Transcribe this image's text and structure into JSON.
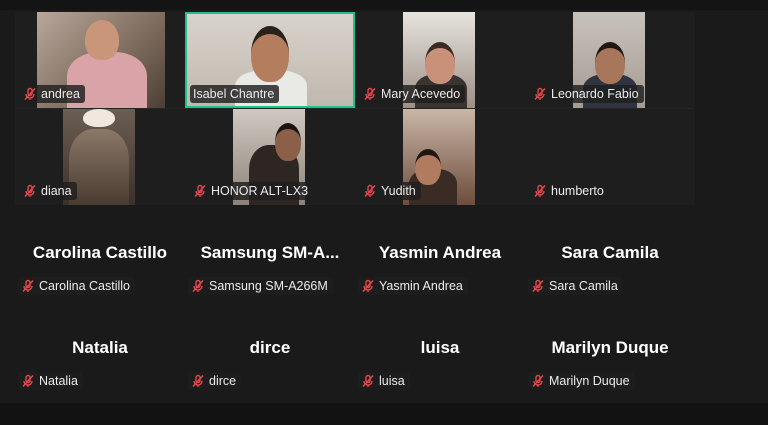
{
  "colors": {
    "active_speaker": "#22c08a",
    "muted_icon": "#e5484d",
    "background": "#1a1a1a"
  },
  "video_tiles": [
    {
      "name": "andrea",
      "muted": true
    },
    {
      "name": "Isabel Chantre",
      "muted": false,
      "active": true
    },
    {
      "name": "Mary Acevedo",
      "muted": true
    },
    {
      "name": "Leonardo Fabio",
      "muted": true
    },
    {
      "name": "diana",
      "muted": true
    },
    {
      "name": "HONOR ALT-LX3",
      "muted": true
    },
    {
      "name": "Yudith",
      "muted": true
    },
    {
      "name": "humberto",
      "muted": true
    }
  ],
  "avatar_tiles": [
    {
      "display": "Carolina Castillo",
      "label": "Carolina Castillo"
    },
    {
      "display": "Samsung  SM-A...",
      "label": "Samsung SM-A266M"
    },
    {
      "display": "Yasmin Andrea",
      "label": "Yasmin Andrea"
    },
    {
      "display": "Sara Camila",
      "label": "Sara Camila"
    },
    {
      "display": "Natalia",
      "label": "Natalia"
    },
    {
      "display": "dirce",
      "label": "dirce"
    },
    {
      "display": "luisa",
      "label": "luisa"
    },
    {
      "display": "Marilyn Duque",
      "label": "Marilyn Duque"
    }
  ]
}
